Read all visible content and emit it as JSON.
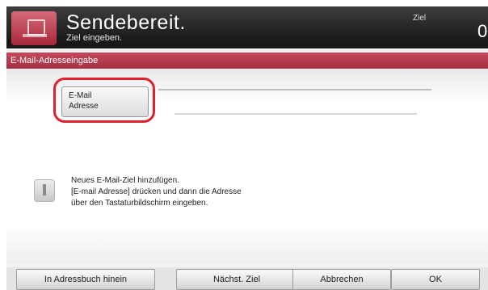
{
  "header": {
    "title": "Sendebereit.",
    "subtitle": "Ziel eingeben.",
    "destination_label": "Ziel",
    "destination_count": "0"
  },
  "section": {
    "title": "E-Mail-Adresseingabe"
  },
  "email_button": {
    "label": "E-Mail\nAdresse"
  },
  "info": {
    "lines": [
      "Neues E-Mail-Ziel hinzufügen.",
      "[E-mail Adresse] drücken und dann die Adresse",
      "über den Tastaturbildschirm eingeben."
    ]
  },
  "buttons": {
    "address_book": "In Adressbuch hinein",
    "next_destination": "Nächst. Ziel",
    "cancel": "Abbrechen",
    "ok": "OK"
  },
  "colors": {
    "accent": "#a52f43",
    "highlight": "#e0202c"
  }
}
